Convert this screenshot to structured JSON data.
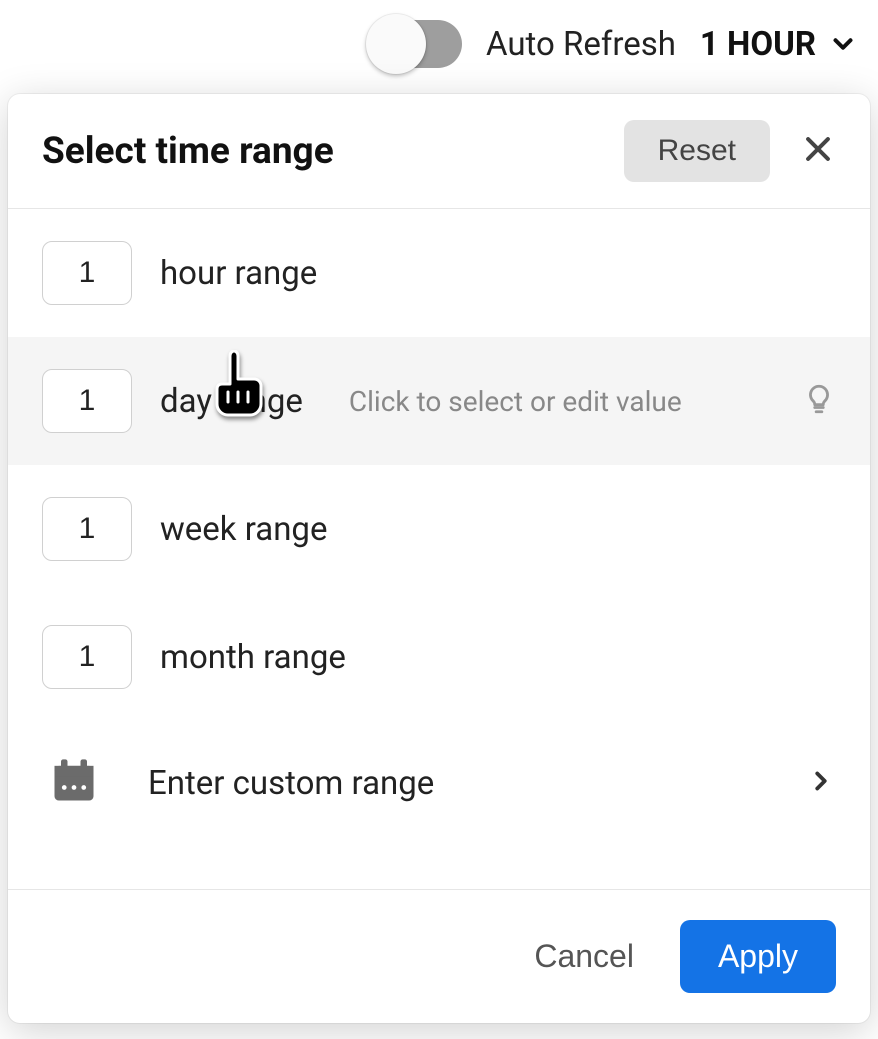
{
  "topbar": {
    "auto_refresh_label": "Auto Refresh",
    "auto_refresh_on": false,
    "current_range": "1 HOUR"
  },
  "dialog": {
    "title": "Select time range",
    "reset_label": "Reset",
    "hint": "Click to select or edit value",
    "ranges": [
      {
        "value": "1",
        "label": "hour range",
        "hovered": false
      },
      {
        "value": "1",
        "label": "day range",
        "hovered": true
      },
      {
        "value": "1",
        "label": "week range",
        "hovered": false
      },
      {
        "value": "1",
        "label": "month range",
        "hovered": false
      }
    ],
    "custom_label": "Enter custom range",
    "cancel_label": "Cancel",
    "apply_label": "Apply"
  }
}
